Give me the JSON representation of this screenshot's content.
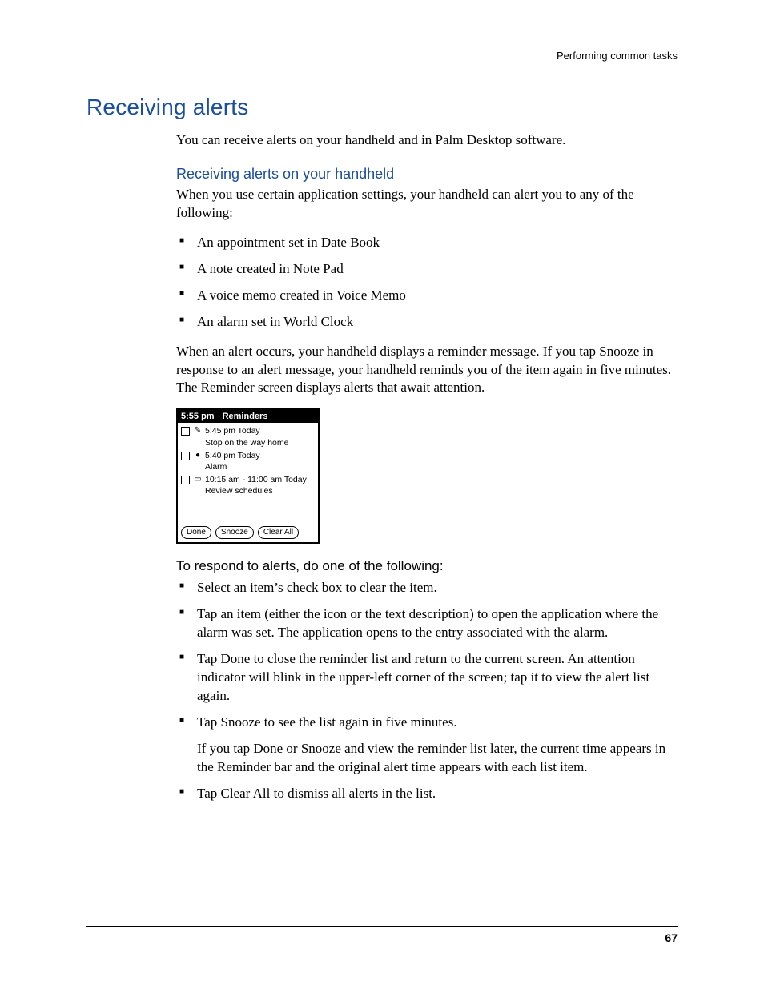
{
  "running_head": "Performing common tasks",
  "page_number": "67",
  "h1": "Receiving alerts",
  "intro": "You can receive alerts on your handheld and in Palm Desktop software.",
  "sub1_head": "Receiving alerts on your handheld",
  "sub1_para": "When you use certain application settings, your handheld can alert you to any of the following:",
  "alert_types": [
    "An appointment set in Date Book",
    "A note created in Note Pad",
    "A voice memo created in Voice Memo",
    "An alarm set in World Clock"
  ],
  "after_list_para": "When an alert occurs, your handheld displays a reminder message. If you tap Snooze in response to an alert message, your handheld reminds you of the item again in five minutes. The Reminder screen displays alerts that await attention.",
  "palm": {
    "time": "5:55 pm",
    "title": "Reminders",
    "rows": [
      {
        "icon": "✎",
        "line": "5:45 pm Today",
        "sub": "Stop on the way home"
      },
      {
        "icon": "●",
        "line": "5:40 pm Today",
        "sub": "Alarm"
      },
      {
        "icon": "▭",
        "line": "10:15 am - 11:00 am Today",
        "sub": "Review schedules"
      }
    ],
    "buttons": {
      "done": "Done",
      "snooze": "Snooze",
      "clear": "Clear All"
    }
  },
  "respond_head": "To respond to alerts, do one of the following:",
  "respond_items": [
    {
      "text": "Select an item’s check box to clear the item."
    },
    {
      "text": "Tap an item (either the icon or the text description) to open the application where the alarm was set. The application opens to the entry associated with the alarm."
    },
    {
      "text": "Tap Done to close the reminder list and return to the current screen. An attention indicator will blink in the upper-left corner of the screen; tap it to view the alert list again."
    },
    {
      "text": "Tap Snooze to see the list again in five minutes.",
      "sub": "If you tap Done or Snooze and view the reminder list later, the current time appears in the Reminder bar and the original alert time appears with each list item."
    },
    {
      "text": "Tap Clear All to dismiss all alerts in the list."
    }
  ]
}
